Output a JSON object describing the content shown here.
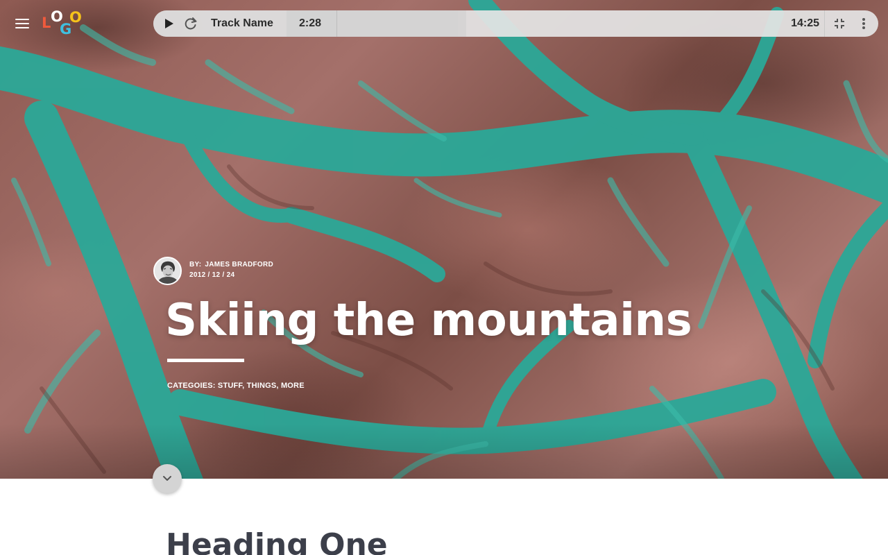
{
  "logo": {
    "letters": [
      "L",
      "O",
      "G",
      "O"
    ]
  },
  "player": {
    "track_name": "Track Name",
    "elapsed": "2:28",
    "total": "14:25",
    "progress": 0.42
  },
  "article": {
    "byline": {
      "by_label": "BY:",
      "author": "JAMES BRADFORD",
      "date": "2012 / 12 / 24"
    },
    "title": "Skiing the mountains",
    "categories": {
      "label": "CATEGOIES:",
      "items": [
        "STUFF",
        "THINGS",
        "MORE"
      ]
    }
  },
  "content": {
    "heading_one": "Heading One"
  },
  "icons": {
    "menu": "hamburger-icon",
    "play": "play-icon",
    "repeat": "repeat-icon",
    "collapse": "collapse-icon",
    "more": "more-vertical-icon",
    "scroll": "chevron-down-icon"
  },
  "colors": {
    "water": "#2aa89a",
    "land": "#8e5a52",
    "logo_l": "#f05a3c",
    "logo_o1": "#ffffff",
    "logo_g": "#3fc0e0",
    "logo_o2": "#f6c21b",
    "heading": "#3c3f4a"
  }
}
